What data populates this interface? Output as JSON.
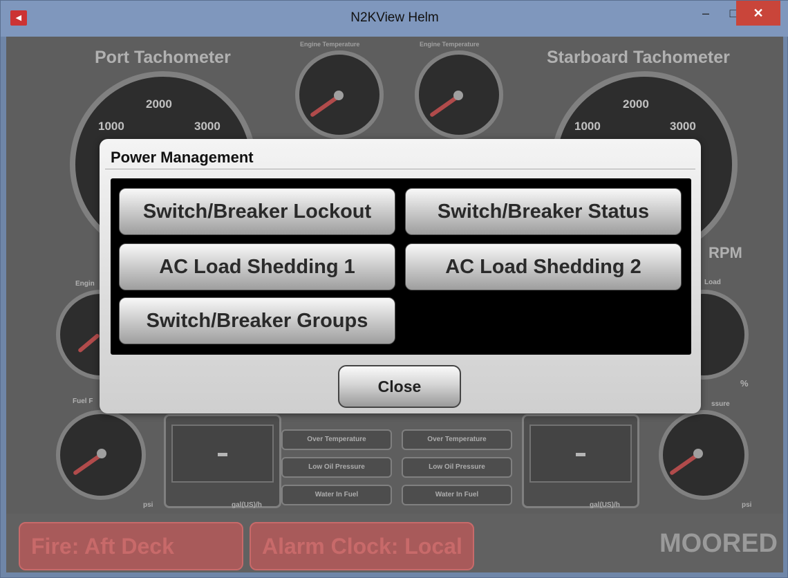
{
  "window": {
    "title": "N2KView Helm",
    "minimize": "–",
    "maximize": "□",
    "close": "✕",
    "app_icon": "N2KView app icon"
  },
  "dashboard": {
    "port_tach_title": "Port Tachometer",
    "starboard_tach_title": "Starboard Tachometer",
    "engine_temp_label": "Engine Temperature",
    "port_ticks": [
      "1000",
      "2000",
      "3000"
    ],
    "starboard_ticks": [
      "1000",
      "2000",
      "3000"
    ],
    "rpm_label": "RPM",
    "load_label": "Load",
    "percent_label": "%",
    "pressure_label": "ssure",
    "psi_left": "psi",
    "psi_right": "psi",
    "fuel_left": "Fuel F",
    "engine_left": "Engin",
    "display_value_left": "-",
    "display_value_right": "-",
    "unit_left": "gal(US)/h",
    "unit_right": "gal(US)/h",
    "alarms_left": [
      "Over Temperature",
      "Low Oil Pressure",
      "Water In Fuel"
    ],
    "alarms_right": [
      "Over Temperature",
      "Low Oil Pressure",
      "Water In Fuel"
    ]
  },
  "status": {
    "alarm1": "Fire: Aft Deck",
    "alarm2": "Alarm Clock: Local",
    "mode": "MOORED"
  },
  "dialog": {
    "title": "Power Management",
    "buttons": [
      "Switch/Breaker Lockout",
      "Switch/Breaker Status",
      "AC Load Shedding 1",
      "AC Load Shedding 2",
      "Switch/Breaker Groups"
    ],
    "close_label": "Close"
  },
  "colors": {
    "needle": "#d63a3a",
    "alarm_red": "#a85a5a",
    "dialog_bg": "#e6e6e6"
  }
}
